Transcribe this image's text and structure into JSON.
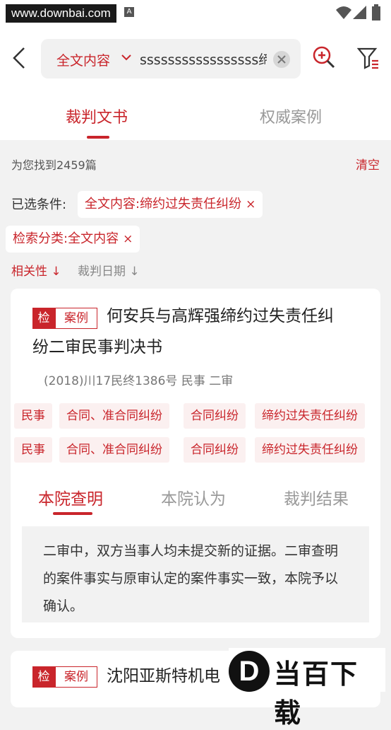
{
  "status_bar": {
    "url_watermark": "www.downbai.com",
    "notification_icon": "A"
  },
  "search": {
    "scope_label": "全文内容",
    "query": "sssssssssssssssss缔",
    "icons": [
      "back-icon",
      "chevron-down-icon",
      "clear-icon",
      "zoom-search-icon",
      "filter-icon"
    ]
  },
  "tabs": [
    {
      "label": "裁判文书",
      "active": true
    },
    {
      "label": "权威案例",
      "active": false
    }
  ],
  "results": {
    "count_text": "为您找到2459篇",
    "clear_label": "清空"
  },
  "conditions": {
    "label": "已选条件:",
    "chips": [
      {
        "label": "全文内容:缔约过失责任纠纷",
        "close": "×"
      },
      {
        "label": "检索分类:全文内容",
        "close": "×"
      }
    ]
  },
  "sort": [
    {
      "label": "相关性 ↓",
      "active": true
    },
    {
      "label": "裁判日期 ↓",
      "active": false
    }
  ],
  "cards": [
    {
      "badge_check": "检",
      "badge_case": "案例",
      "title_line1": "何安兵与高辉强缔约过失责任纠",
      "title_line2": "纷二审民事判决书",
      "meta": "(2018)川17民终1386号   民事  二审",
      "tags_row1": [
        "民事",
        "合同、准合同纠纷",
        "合同纠纷",
        "缔约过失责任纠纷"
      ],
      "tags_row2": [
        "民事",
        "合同、准合同纠纷",
        "合同纠纷",
        "缔约过失责任纠纷"
      ],
      "subtabs": [
        {
          "label": "本院查明",
          "active": true
        },
        {
          "label": "本院认为",
          "active": false
        },
        {
          "label": "裁判结果",
          "active": false
        }
      ],
      "excerpt": "二审中，双方当事人均未提交新的证据。二审查明的案件事实与原审认定的案件事实一致，本院予以确认。"
    },
    {
      "badge_check": "检",
      "badge_case": "案例",
      "title_line1": "沈阳亚斯特机电"
    }
  ],
  "logo_watermark": {
    "mark": "D",
    "text": "当百下载"
  },
  "colors": {
    "accent": "#c9252b",
    "background": "#f2f2f2",
    "card": "#ffffff"
  }
}
